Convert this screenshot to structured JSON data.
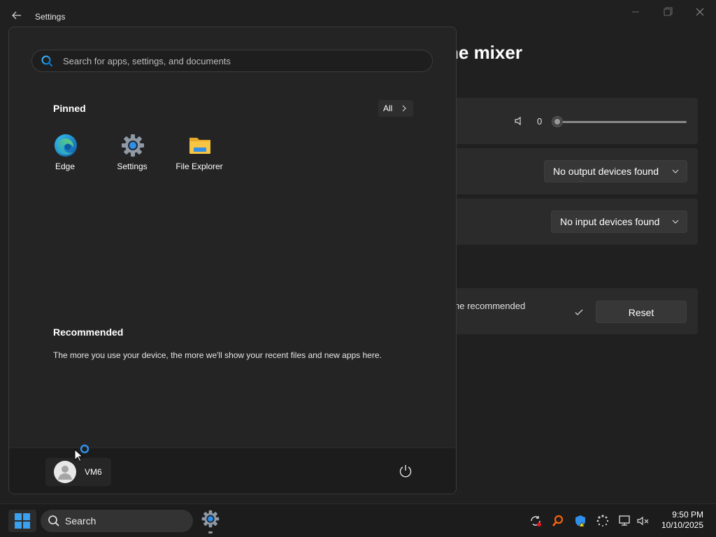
{
  "settings_window": {
    "title": "Settings",
    "heading": "he mixer",
    "volume_value": "0",
    "output_dropdown": "No output devices found",
    "input_dropdown": "No input devices found",
    "recommended_text": "he recommended",
    "reset_label": "Reset"
  },
  "start_menu": {
    "search_placeholder": "Search for apps, settings, and documents",
    "pinned_title": "Pinned",
    "all_label": "All",
    "pinned_apps": [
      {
        "label": "Edge",
        "icon": "edge-icon"
      },
      {
        "label": "Settings",
        "icon": "gear-icon"
      },
      {
        "label": "File Explorer",
        "icon": "folder-icon"
      }
    ],
    "recommended_title": "Recommended",
    "recommended_desc": "The more you use your device, the more we'll show your recent files and new apps here.",
    "user_name": "VM6"
  },
  "taskbar": {
    "search_label": "Search",
    "time": "9:50 PM",
    "date": "10/10/2025"
  },
  "colors": {
    "accent": "#0078d4",
    "folder_yellow": "#f6c543",
    "background": "#202020"
  }
}
